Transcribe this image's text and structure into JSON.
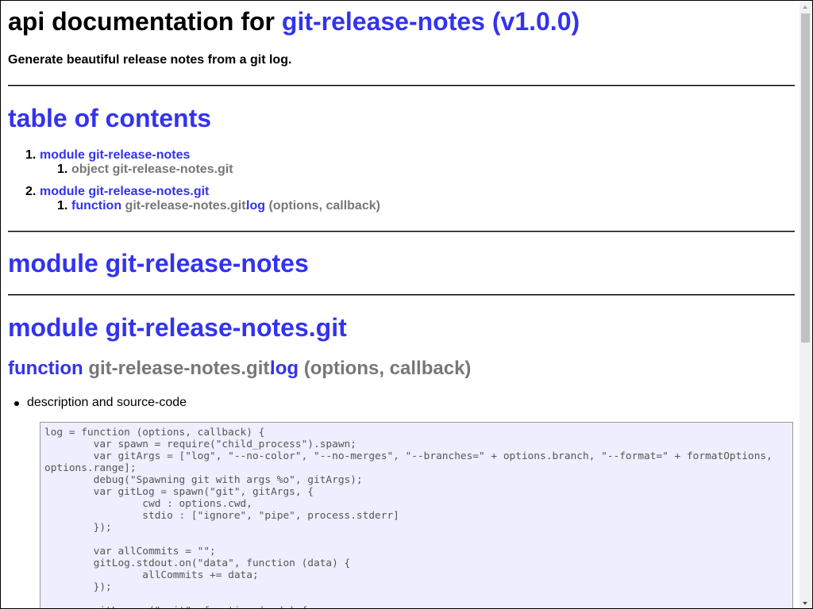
{
  "header": {
    "prefix": "api documentation for",
    "package": "git-release-notes (v1.0.0)",
    "description": "Generate beautiful release notes from a git log."
  },
  "toc": {
    "title": "table of contents",
    "item1_label": "module git-release-notes",
    "item1_sub_label": "object git-release-notes.git",
    "item2_label": "module git-release-notes.git",
    "item2_sub_type": "function",
    "item2_sub_path": "git-release-notes.git.",
    "item2_sub_name": "log",
    "item2_sub_params": "(options, callback)"
  },
  "module1": {
    "title": "module git-release-notes"
  },
  "module2": {
    "title": "module git-release-notes.git",
    "fn_type": "function",
    "fn_path": "git-release-notes.git.",
    "fn_name": "log",
    "fn_params": "(options, callback)",
    "bullet": "description and source-code",
    "code": "log = function (options, callback) {\n\tvar spawn = require(\"child_process\").spawn;\n\tvar gitArgs = [\"log\", \"--no-color\", \"--no-merges\", \"--branches=\" + options.branch, \"--format=\" + formatOptions, options.range];\n\tdebug(\"Spawning git with args %o\", gitArgs);\n\tvar gitLog = spawn(\"git\", gitArgs, {\n\t\tcwd : options.cwd,\n\t\tstdio : [\"ignore\", \"pipe\", process.stderr]\n\t});\n\n\tvar allCommits = \"\";\n\tgitLog.stdout.on(\"data\", function (data) {\n\t\tallCommits += data;\n\t});\n\n\tgitLog.on(\"exit\", function (code) {"
  }
}
